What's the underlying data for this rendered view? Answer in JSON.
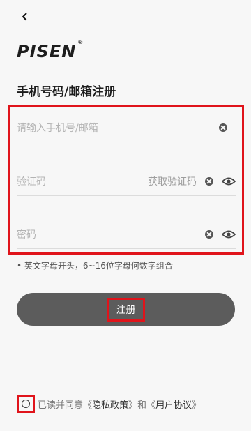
{
  "header": {
    "back_icon": "chevron-left-icon",
    "logo_text": "PISEN",
    "logo_mark": "®",
    "title": "手机号码/邮箱注册"
  },
  "form": {
    "account_placeholder": "请输入手机号/邮箱",
    "code_placeholder": "验证码",
    "get_code_label": "获取验证码",
    "password_placeholder": "密码",
    "password_hint": "• 英文字母开头，6~16位字母何数字组合"
  },
  "actions": {
    "register_label": "注册"
  },
  "agreement": {
    "prefix": "已读并同意《",
    "privacy_label": "隐私政策",
    "middle": "》和《",
    "terms_label": "用户协议",
    "suffix": "》"
  },
  "colors": {
    "highlight": "#e0141b",
    "button_bg": "#5c5c5c",
    "background": "#f7f7f7"
  }
}
